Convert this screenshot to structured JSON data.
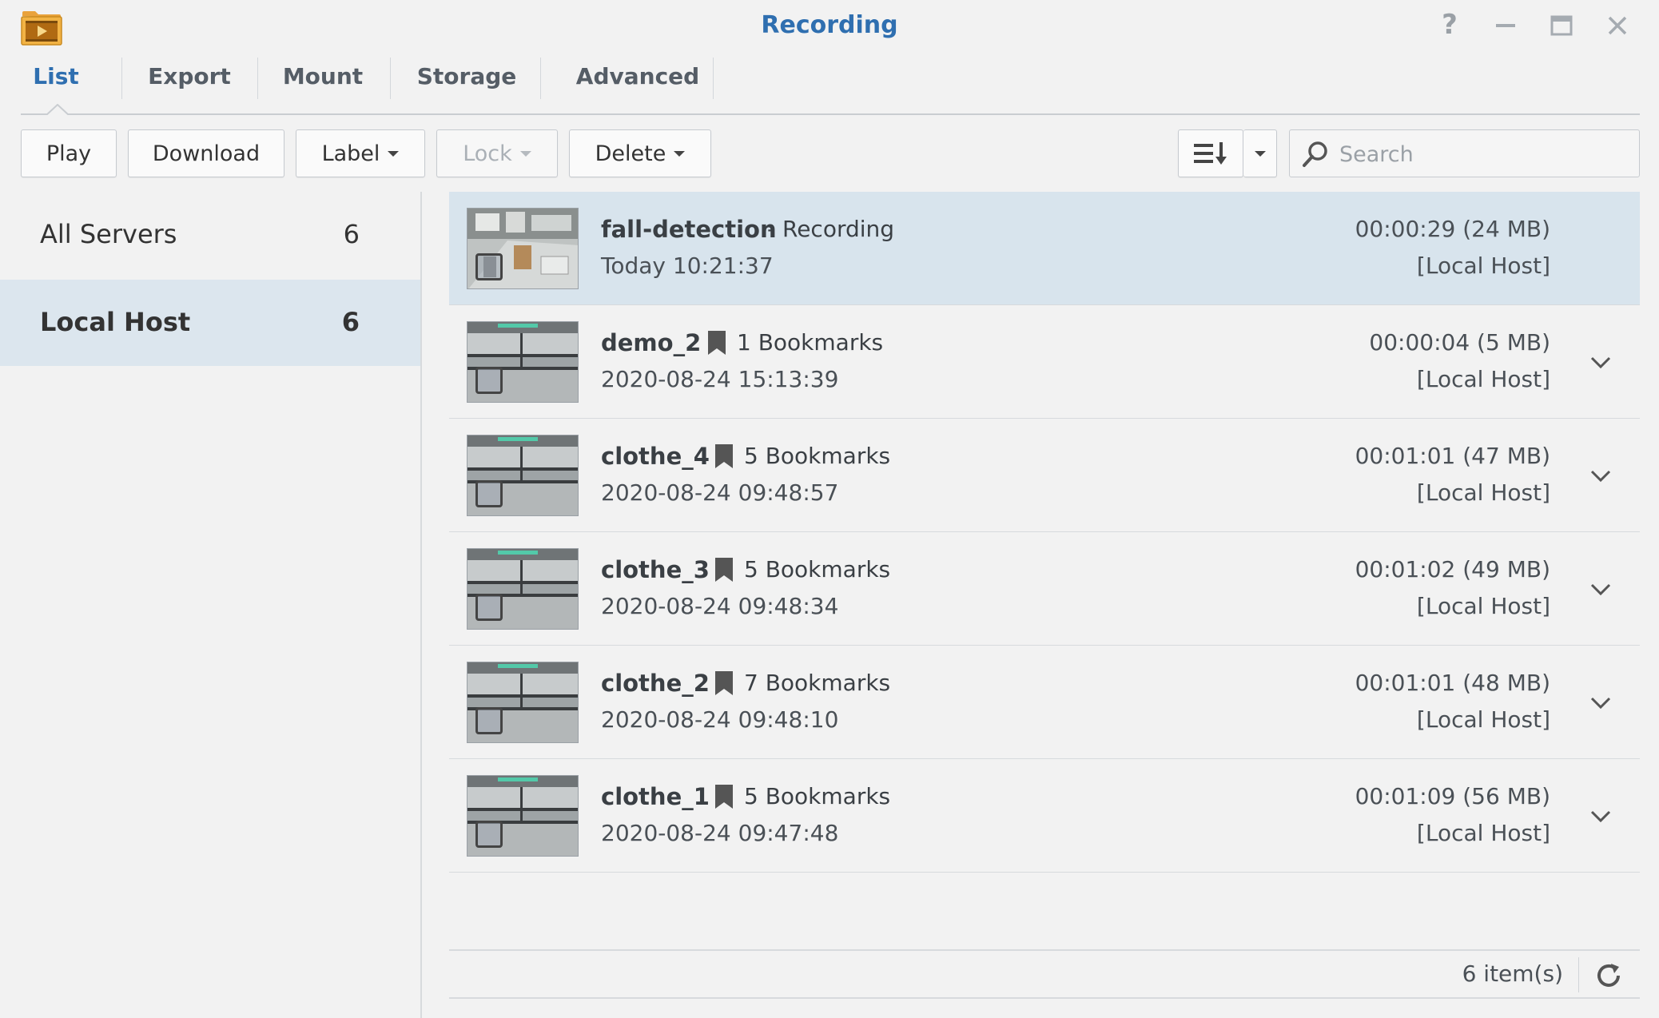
{
  "window": {
    "title": "Recording",
    "help_label": "?"
  },
  "tabs": [
    {
      "label": "List"
    },
    {
      "label": "Export"
    },
    {
      "label": "Mount"
    },
    {
      "label": "Storage"
    },
    {
      "label": "Advanced"
    }
  ],
  "toolbar": {
    "play_label": "Play",
    "download_label": "Download",
    "label_label": "Label",
    "lock_label": "Lock",
    "delete_label": "Delete",
    "search_placeholder": "Search"
  },
  "sidebar": {
    "items": [
      {
        "label": "All Servers",
        "count": "6"
      },
      {
        "label": "Local Host",
        "count": "6"
      }
    ]
  },
  "recordings": [
    {
      "name": "fall-detection",
      "extra": "- Recording",
      "datetime": "Today 10:21:37",
      "duration": "00:00:29 (24 MB)",
      "server": "[Local Host]"
    },
    {
      "name": "demo_2",
      "extra": "1 Bookmarks",
      "datetime": "2020-08-24 15:13:39",
      "duration": "00:00:04 (5 MB)",
      "server": "[Local Host]"
    },
    {
      "name": "clothe_4",
      "extra": "5 Bookmarks",
      "datetime": "2020-08-24 09:48:57",
      "duration": "00:01:01 (47 MB)",
      "server": "[Local Host]"
    },
    {
      "name": "clothe_3",
      "extra": "5 Bookmarks",
      "datetime": "2020-08-24 09:48:34",
      "duration": "00:01:02 (49 MB)",
      "server": "[Local Host]"
    },
    {
      "name": "clothe_2",
      "extra": "7 Bookmarks",
      "datetime": "2020-08-24 09:48:10",
      "duration": "00:01:01 (48 MB)",
      "server": "[Local Host]"
    },
    {
      "name": "clothe_1",
      "extra": "5 Bookmarks",
      "datetime": "2020-08-24 09:47:48",
      "duration": "00:01:09 (56 MB)",
      "server": "[Local Host]"
    }
  ],
  "footer": {
    "item_count": "6 item(s)"
  },
  "colors": {
    "accent": "#2f6fb0",
    "selected_row": "#d8e4ed",
    "selected_sidebar": "#dce6ee"
  }
}
